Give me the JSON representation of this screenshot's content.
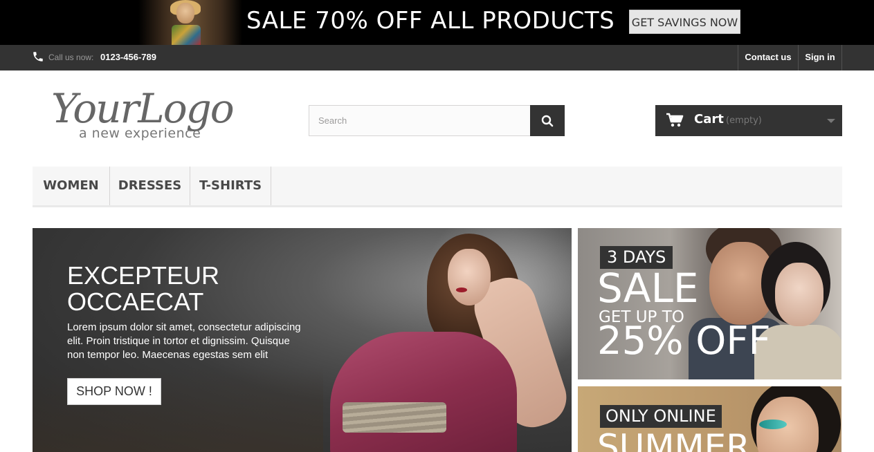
{
  "promo": {
    "text": "SALE 70% OFF ALL PRODUCTS",
    "button": "GET SAVINGS NOW"
  },
  "topnav": {
    "call_label": "Call us now:",
    "phone": "0123-456-789",
    "contact": "Contact us",
    "signin": "Sign in"
  },
  "header": {
    "logo_text": "YourLogo",
    "logo_tagline": "a new experience",
    "search_placeholder": "Search",
    "cart_label": "Cart",
    "cart_status": "(empty)"
  },
  "menu": {
    "items": [
      "WOMEN",
      "DRESSES",
      "T-SHIRTS"
    ]
  },
  "slider": {
    "title": "EXCEPTEUR OCCAECAT",
    "text": "Lorem ipsum dolor sit amet, consectetur adipiscing elit. Proin tristique in tortor et dignissim. Quisque non tempor leo. Maecenas egestas sem elit",
    "button": "SHOP NOW !"
  },
  "banners": {
    "banner1": {
      "tag": "3 DAYS",
      "headline": "SALE",
      "subline": "GET UP TO",
      "offer": "25% OFF"
    },
    "banner2": {
      "tag": "ONLY ONLINE",
      "headline": "SUMMER"
    }
  },
  "colors": {
    "dark": "#333333",
    "promo_bg": "#000000",
    "menu_bg": "#f6f6f6"
  }
}
